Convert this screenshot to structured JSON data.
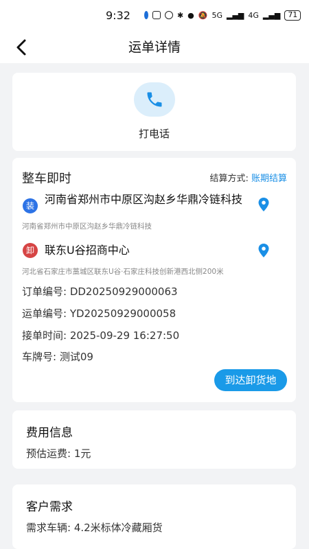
{
  "status_bar": {
    "time": "9:32",
    "network": "5G",
    "network2": "4G",
    "battery": "71",
    "icons": [
      "app-red-icon",
      "app-red-icon",
      "app-blue-ring-icon",
      "nfc-icon",
      "alarm-icon",
      "bluetooth-icon",
      "location-icon",
      "mute-icon",
      "signal-icon",
      "signal-icon",
      "battery-icon"
    ]
  },
  "header": {
    "title": "运单详情",
    "back_icon": "chevron-left-icon"
  },
  "contact": {
    "call_label": "打电话",
    "call_icon": "phone-icon",
    "accent": "#1a8fe6"
  },
  "order": {
    "type": "整车即时",
    "settlement_label": "结算方式:",
    "settlement_value": "账期结算",
    "load": {
      "tag": "装",
      "name": "河南省郑州市中原区沟赵乡华鼎冷链科技",
      "detail": "河南省郑州市中原区沟赵乡华鼎冷链科技"
    },
    "unload": {
      "tag": "卸",
      "name": "联东U谷招商中心",
      "detail": "河北省石家庄市藁城区联东U谷·石家庄科技创新港西北侧200米"
    },
    "order_no": "订单编号: DD20250929000063",
    "waybill_no": "运单编号: YD20250929000058",
    "accept_time": "接单时间: 2025-09-29 16:27:50",
    "plate": "车牌号: 测试09",
    "action_label": "到达卸货地"
  },
  "fee": {
    "title": "费用信息",
    "estimate": "预估运费:  1元"
  },
  "requirements": {
    "title": "客户需求",
    "vehicle": "需求车辆: 4.2米标体冷藏厢货"
  },
  "colors": {
    "primary": "#1a9ae8",
    "load_tag": "#2d73e6",
    "unload_tag": "#d64545",
    "background": "#f2f3f5"
  }
}
